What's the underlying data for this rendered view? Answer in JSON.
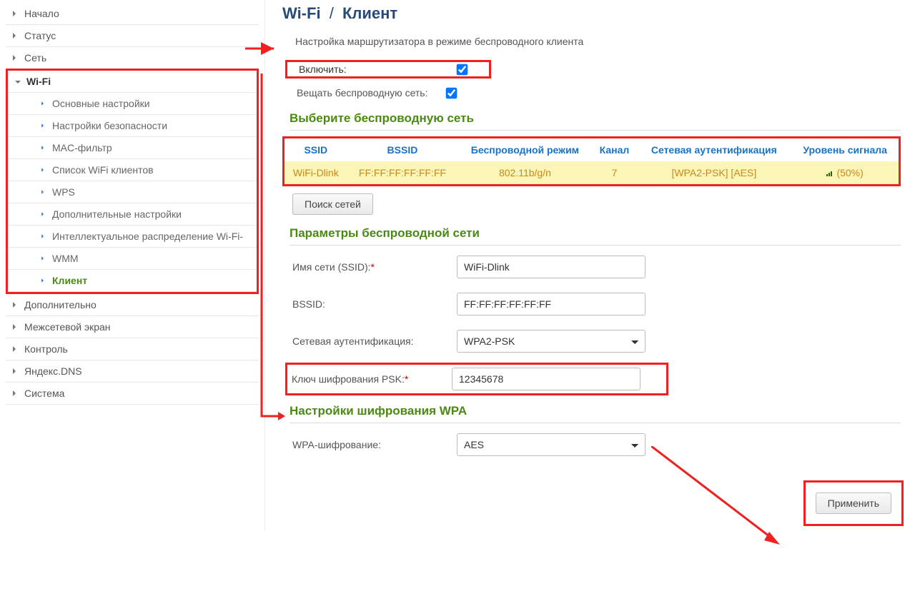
{
  "nav": {
    "home": "Начало",
    "status": "Статус",
    "net": "Сеть",
    "wifi": "Wi-Fi",
    "wifi_sub": {
      "basic": "Основные настройки",
      "security": "Настройки безопасности",
      "mac": "MAC-фильтр",
      "clients": "Список WiFi клиентов",
      "wps": "WPS",
      "adv": "Дополнительные настройки",
      "intell": "Интеллектуальное распределение Wi-Fi-",
      "wmm": "WMM",
      "client": "Клиент"
    },
    "extra": "Дополнительно",
    "firewall": "Межсетевой экран",
    "control": "Контроль",
    "yandex": "Яндекс.DNS",
    "system": "Система"
  },
  "breadcrumb": {
    "a": "Wi-Fi",
    "b": "Клиент"
  },
  "description": "Настройка маршрутизатора в режиме беспроводного клиента",
  "toggles": {
    "enable_label": "Включить:",
    "broadcast_label": "Вещать беспроводную сеть:"
  },
  "sections": {
    "pick": "Выберите беспроводную сеть",
    "params": "Параметры беспроводной сети",
    "wpa": "Настройки шифрования WPA"
  },
  "table": {
    "headers": {
      "ssid": "SSID",
      "bssid": "BSSID",
      "mode": "Беспроводной режим",
      "channel": "Канал",
      "auth": "Сетевая аутентификация",
      "signal": "Уровень сигнала"
    },
    "row": {
      "ssid": "WiFi-Dlink",
      "bssid": "FF:FF:FF:FF:FF:FF",
      "mode": "802.11b/g/n",
      "channel": "7",
      "auth": "[WPA2-PSK] [AES]",
      "signal": "(50%)"
    }
  },
  "buttons": {
    "search": "Поиск сетей",
    "apply": "Применить"
  },
  "form": {
    "ssid_label": "Имя сети (SSID):",
    "ssid_value": "WiFi-Dlink",
    "bssid_label": "BSSID:",
    "bssid_value": "FF:FF:FF:FF:FF:FF",
    "auth_label": "Сетевая аутентификация:",
    "auth_value": "WPA2-PSK",
    "psk_label": "Ключ шифрования PSK:",
    "psk_value": "12345678",
    "wpa_enc_label": "WPA-шифрование:",
    "wpa_enc_value": "AES"
  }
}
